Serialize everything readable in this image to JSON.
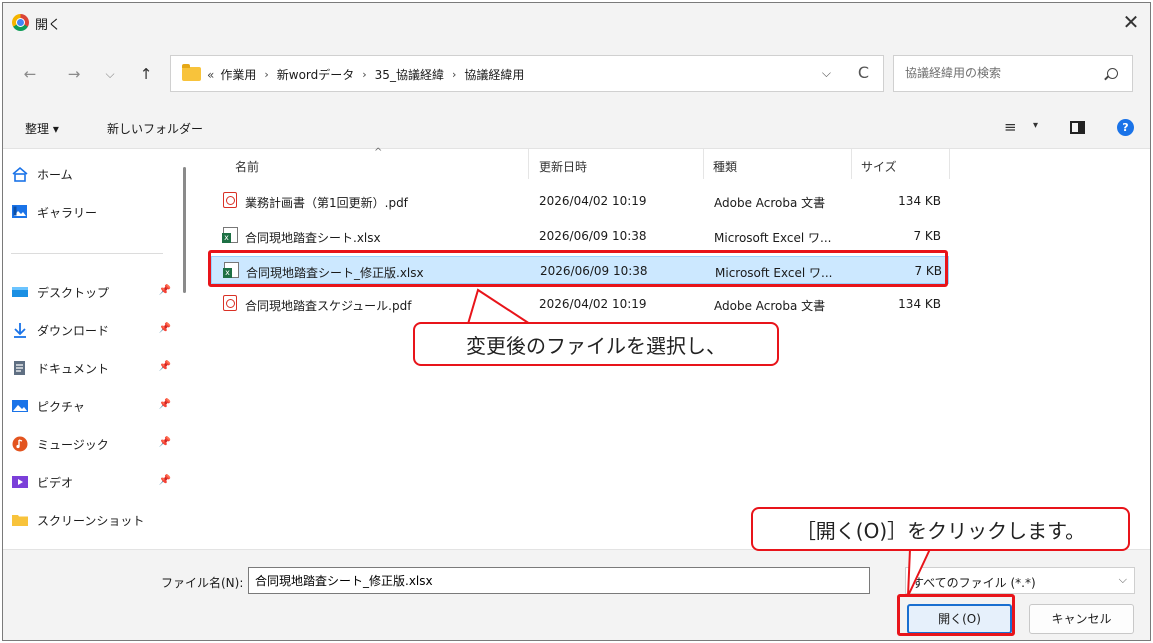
{
  "window": {
    "title": "開く",
    "close_glyph": "✕"
  },
  "nav": {
    "back": "←",
    "forward": "→",
    "recent": "⌵",
    "up": "↑"
  },
  "address": {
    "overflow": "«",
    "crumbs": [
      "作業用",
      "新wordデータ",
      "35_協議経緯",
      "協議経緯用"
    ],
    "separator": "›",
    "dropdown": "⌵",
    "refresh": "C"
  },
  "search": {
    "placeholder": "協議経緯用の検索"
  },
  "commands": {
    "organize": "整理 ▾",
    "new_folder": "新しいフォルダー",
    "view_glyph": "≡",
    "view_dropdown": "▾",
    "help_glyph": "?"
  },
  "sidebar": {
    "items": [
      {
        "label": "ホーム",
        "icon": "home-icon"
      },
      {
        "label": "ギャラリー",
        "icon": "gallery-icon"
      },
      {
        "label": "デスクトップ",
        "icon": "desktop-icon",
        "pinned": true
      },
      {
        "label": "ダウンロード",
        "icon": "download-icon",
        "pinned": true
      },
      {
        "label": "ドキュメント",
        "icon": "documents-icon",
        "pinned": true
      },
      {
        "label": "ピクチャ",
        "icon": "pictures-icon",
        "pinned": true
      },
      {
        "label": "ミュージック",
        "icon": "music-icon",
        "pinned": true
      },
      {
        "label": "ビデオ",
        "icon": "video-icon",
        "pinned": true
      },
      {
        "label": "スクリーンショット",
        "icon": "folder-icon"
      }
    ]
  },
  "columns": {
    "name": "名前",
    "sort_glyph": "^",
    "modified": "更新日時",
    "type": "種類",
    "size": "サイズ"
  },
  "files": [
    {
      "name": "業務計画書（第1回更新）.pdf",
      "modified": "2026/04/02 10:19",
      "type": "Adobe Acroba 文書",
      "size": "134 KB",
      "icon": "pdf-icon",
      "selected": false
    },
    {
      "name": "合同現地踏査シート.xlsx",
      "modified": "2026/06/09 10:38",
      "type": "Microsoft Excel ワ...",
      "size": "7 KB",
      "icon": "excel-icon",
      "selected": false
    },
    {
      "name": "合同現地踏査シート_修正版.xlsx",
      "modified": "2026/06/09 10:38",
      "type": "Microsoft Excel ワ...",
      "size": "7 KB",
      "icon": "excel-icon",
      "selected": true
    },
    {
      "name": "合同現地踏査スケジュール.pdf",
      "modified": "2026/04/02 10:19",
      "type": "Adobe Acroba 文書",
      "size": "134 KB",
      "icon": "pdf-icon",
      "selected": false
    }
  ],
  "callouts": {
    "select_file": "変更後のファイルを選択し、",
    "click_open": "［開く(O)］をクリックします。"
  },
  "bottom": {
    "filename_label": "ファイル名(N):",
    "filename_value": "合同現地踏査シート_修正版.xlsx",
    "filetype_value": "すべてのファイル (*.*)",
    "filetype_dropdown": "⌵",
    "open_button": "開く(O)",
    "cancel_button": "キャンセル"
  },
  "colors": {
    "highlight_red": "#e8141a",
    "selection_bg": "#cce8ff",
    "accent_blue": "#1a6fd0"
  }
}
